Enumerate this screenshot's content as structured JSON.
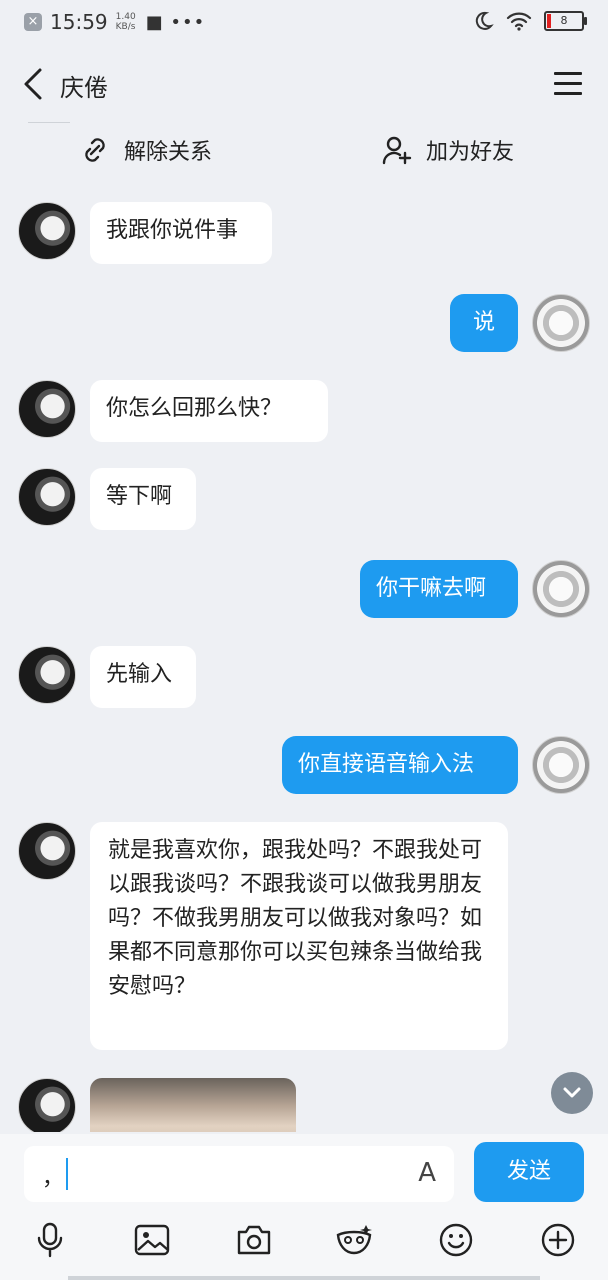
{
  "status_bar": {
    "time": "15:59",
    "speed_value": "1.40",
    "speed_unit": "KB/s",
    "dots": "■ •••",
    "battery": "8"
  },
  "header": {
    "title": "庆倦"
  },
  "actions": {
    "unlink_label": "解除关系",
    "add_friend_label": "加为好友"
  },
  "messages": [
    {
      "side": "in",
      "text": "我跟你说件事"
    },
    {
      "side": "out",
      "text": "说"
    },
    {
      "side": "in",
      "text": "你怎么回那么快？"
    },
    {
      "side": "in",
      "text": "等下啊"
    },
    {
      "side": "out",
      "text": "你干嘛去啊"
    },
    {
      "side": "in",
      "text": "先输入"
    },
    {
      "side": "out",
      "text": "你直接语音输入法"
    },
    {
      "side": "in",
      "text": "就是我喜欢你，跟我处吗？不跟我处可以跟我谈吗？不跟我谈可以做我男朋友吗？不做我男朋友可以做我对象吗？如果都不同意那你可以买包辣条当做给我安慰吗？"
    }
  ],
  "input": {
    "value": "，",
    "send_label": "发送"
  },
  "colors": {
    "accent": "#1e9bf0",
    "background": "#eef0f4"
  }
}
